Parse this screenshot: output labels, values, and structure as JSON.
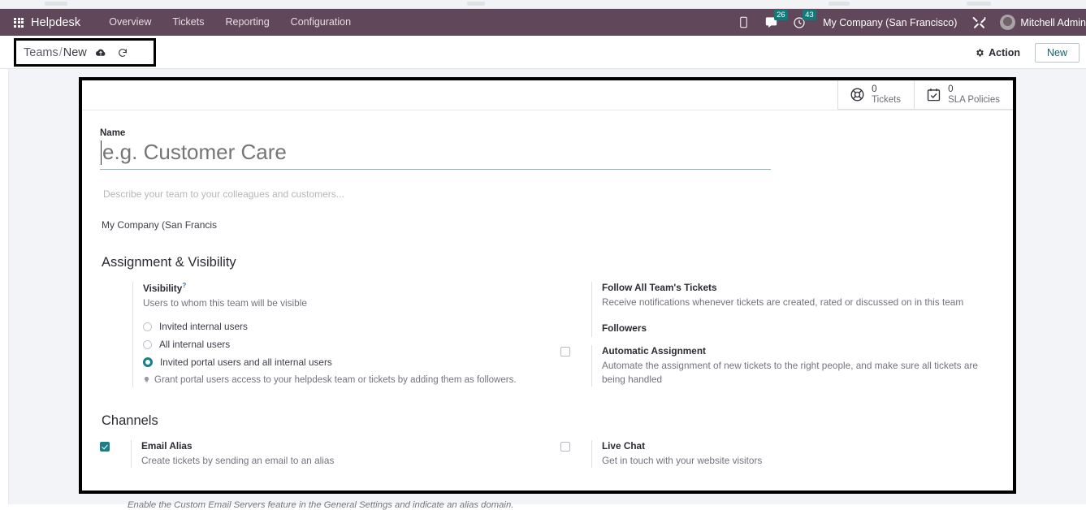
{
  "navbar": {
    "apps_icon": "grid-apps-icon",
    "brand": "Helpdesk",
    "menu": [
      {
        "label": "Overview"
      },
      {
        "label": "Tickets"
      },
      {
        "label": "Reporting"
      },
      {
        "label": "Configuration"
      }
    ],
    "icons": {
      "phone": "phone-icon",
      "messages": "chat-icon",
      "activities": "clock-icon",
      "tools": "tools-icon"
    },
    "messages_count": "26",
    "activities_count": "43",
    "company": "My Company (San Francisco)",
    "user": "Mitchell Admin",
    "accent_color": "#61475a",
    "badge_color": "#0f7b7b"
  },
  "control_panel": {
    "breadcrumb_root": "Teams",
    "breadcrumb_sep": "/",
    "breadcrumb_current": "New",
    "save_icon": "cloud-upload-icon",
    "discard_icon": "undo-icon",
    "action_label": "Action",
    "action_icon": "gear-icon",
    "new_label": "New"
  },
  "stats": [
    {
      "icon": "life-buoy-icon",
      "value": "0",
      "label": "Tickets"
    },
    {
      "icon": "calendar-check-icon",
      "value": "0",
      "label": "SLA Policies"
    }
  ],
  "form": {
    "name_label": "Name",
    "name_value": "",
    "name_placeholder": "e.g. Customer Care",
    "description_placeholder": "Describe your team to your colleagues and customers...",
    "company": "My Company (San Francis",
    "sections": {
      "assignment": {
        "title": "Assignment & Visibility",
        "visibility": {
          "title": "Visibility",
          "help_marker": "?",
          "help": "Users to whom this team will be visible",
          "options": [
            {
              "label": "Invited internal users",
              "selected": false
            },
            {
              "label": "All internal users",
              "selected": false
            },
            {
              "label": "Invited portal users and all internal users",
              "selected": true
            }
          ],
          "tip_icon": "lightbulb-icon",
          "tip": "Grant portal users access to your helpdesk team or tickets by adding them as followers."
        },
        "follow_all": {
          "title": "Follow All Team's Tickets",
          "help": "Receive notifications whenever tickets are created, rated or discussed on in this team"
        },
        "followers": {
          "title": "Followers"
        },
        "automatic_assignment": {
          "title": "Automatic Assignment",
          "help": "Automate the assignment of new tickets to the right people, and make sure all tickets are being handled",
          "checked": false
        }
      },
      "channels": {
        "title": "Channels",
        "email_alias": {
          "title": "Email Alias",
          "help": "Create tickets by sending an email to an alias",
          "checked": true
        },
        "live_chat": {
          "title": "Live Chat",
          "help": "Get in touch with your website visitors",
          "checked": false
        },
        "bottom_tip": "Enable the Custom Email Servers feature in the General Settings and indicate an alias domain."
      }
    }
  },
  "annotations": {
    "highlight_box": "breadcrumb-highlight",
    "arrow": "left-pointing-arrow",
    "sheet_box": "form-highlight"
  },
  "colors": {
    "accent_teal": "#1b7f86",
    "navbar_purple": "#61475a",
    "page_bg": "#f3f4f7"
  }
}
